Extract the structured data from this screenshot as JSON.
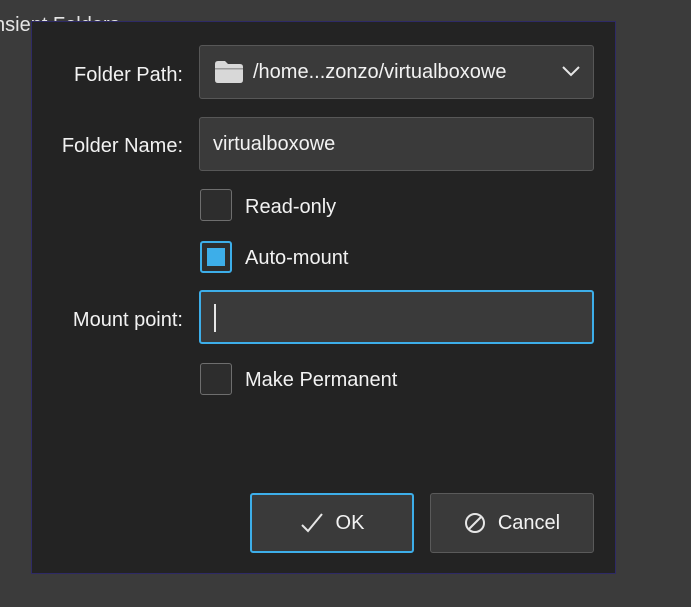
{
  "background": {
    "window_title_fragment": "nsient Folders"
  },
  "dialog": {
    "folder_path": {
      "label": "Folder Path:",
      "value": "/home...zonzo/virtualboxowe",
      "icon": "folder-icon"
    },
    "folder_name": {
      "label": "Folder Name:",
      "value": "virtualboxowe"
    },
    "read_only": {
      "label": "Read-only",
      "checked": false
    },
    "auto_mount": {
      "label": "Auto-mount",
      "checked": true
    },
    "mount_point": {
      "label": "Mount point:",
      "value": ""
    },
    "make_permanent": {
      "label": "Make Permanent",
      "checked": false
    },
    "buttons": {
      "ok_label": "OK",
      "cancel_label": "Cancel"
    }
  },
  "colors": {
    "accent": "#3daee9",
    "dialog_bg": "#232323",
    "field_bg": "#3a3a3a",
    "window_bg": "#3b3b3b"
  }
}
